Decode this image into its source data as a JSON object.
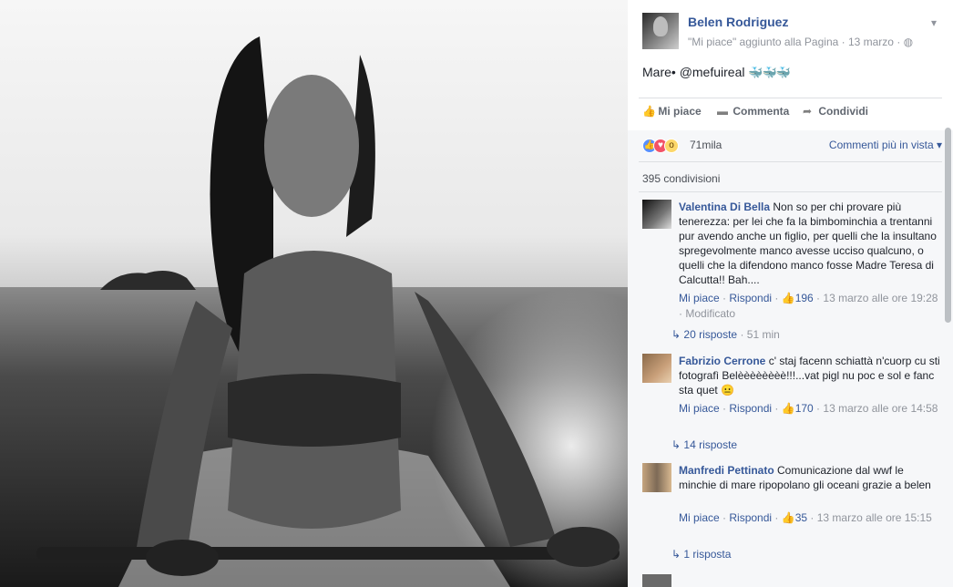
{
  "post": {
    "author": "Belen Rodriguez",
    "subtitle": "\"Mi piace\" aggiunto alla Pagina · 13 marzo · ",
    "globe_icon": "globe-icon",
    "text": "Mare• @mefuireal ",
    "text_emoji": "🐳🐳🐳"
  },
  "actions": {
    "like": "Mi piace",
    "comment": "Commenta",
    "share": "Condividi"
  },
  "reactions": {
    "count": "71mila",
    "sort": "Commenti più in vista ▾"
  },
  "shares": "395 condivisioni",
  "comments": [
    {
      "author": "Valentina Di Bella",
      "text": "Non so per chi provare più tenerezza: per lei che fa la bimbominchia a trentanni pur avendo anche un figlio, per quelli che la insultano spregevolmente manco avesse ucciso qualcuno, o quelli che la difendono manco fosse Madre Teresa di Calcutta!! Bah....",
      "like": "Mi piace",
      "reply": "Rispondi",
      "likes": "196",
      "time": "13 marzo alle ore 19:28",
      "edited": "Modificato",
      "replies": "20 risposte",
      "replies_time": "51 min"
    },
    {
      "author": "Fabrizio Cerrone",
      "text": "c' staj facenn schiattà n'cuorp cu sti fotografì Belèèèèèèèè!!!...vat pigl nu poc e sol e fanc sta quet 😐",
      "like": "Mi piace",
      "reply": "Rispondi",
      "likes": "170",
      "time": "13 marzo alle ore 14:58",
      "replies": "14 risposte"
    },
    {
      "author": "Manfredi Pettinato",
      "text": "Comunicazione dal wwf le minchie di mare ripopolano gli oceani grazie a belen",
      "like": "Mi piace",
      "reply": "Rispondi",
      "likes": "35",
      "time": "13 marzo alle ore 15:15",
      "replies": "1 risposta"
    }
  ]
}
